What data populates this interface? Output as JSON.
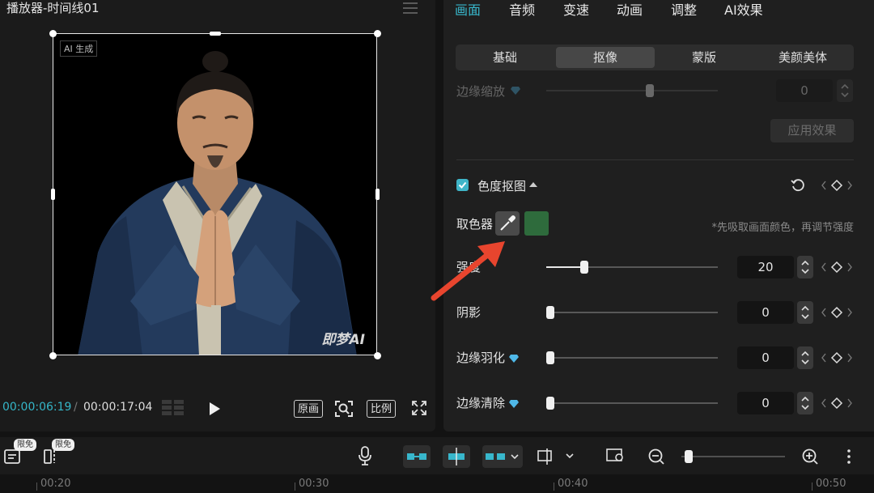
{
  "player": {
    "title": "播放器-时间线01",
    "watermark_top_left": "AI 生成",
    "watermark_bottom_right": "即梦AI",
    "time_current": "00:00:06:19",
    "time_separator": "/",
    "time_total": "00:00:17:04",
    "btn_original": "原画",
    "btn_ratio": "比例"
  },
  "tabs": {
    "main": [
      "画面",
      "音频",
      "变速",
      "动画",
      "调整",
      "AI效果"
    ],
    "active_main": "画面",
    "sub": [
      "基础",
      "抠像",
      "蒙版",
      "美颜美体"
    ],
    "active_sub": "抠像"
  },
  "edge_scale": {
    "label": "边缘缩放",
    "value": "0"
  },
  "apply_button": "应用效果",
  "chroma": {
    "title": "色度抠图",
    "checked": true,
    "picker_label": "取色器",
    "picked_color": "#2e6b3c",
    "hint": "*先吸取画面颜色，再调节强度"
  },
  "sliders": [
    {
      "label": "强度",
      "value": "20",
      "level": 0.2
    },
    {
      "label": "阴影",
      "value": "0",
      "level": 0
    },
    {
      "label": "边缘羽化",
      "value": "0",
      "level": 0,
      "premium": true
    },
    {
      "label": "边缘清除",
      "value": "0",
      "level": 0,
      "premium": true
    }
  ],
  "toolbar": {
    "badge_1": "限免",
    "badge_2": "限免"
  },
  "ruler": [
    "00:20",
    "00:30",
    "00:40",
    "00:50"
  ],
  "colors": {
    "accent": "#38b7cc",
    "annotation_arrow": "#e8452e"
  }
}
